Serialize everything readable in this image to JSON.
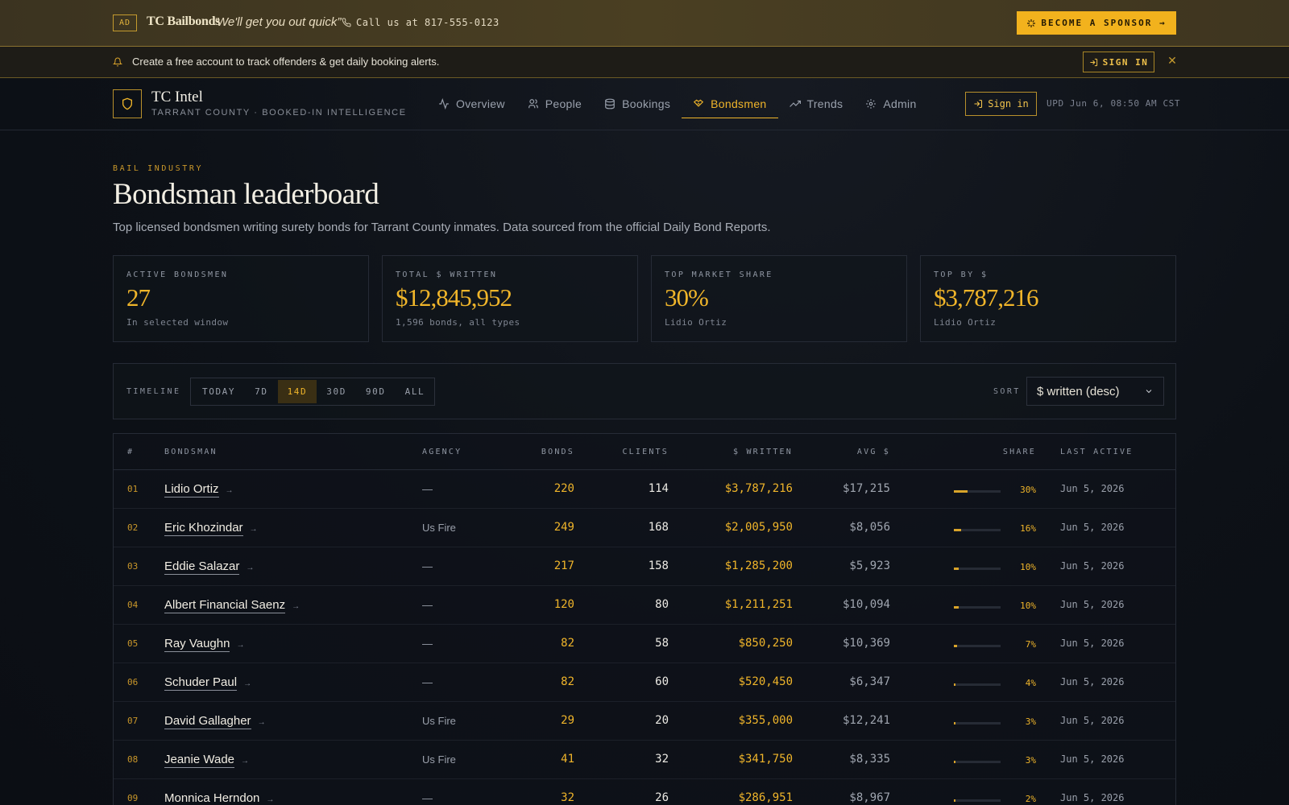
{
  "ad": {
    "tag": "AD",
    "brand": "TC Bailbonds",
    "tagline": "“We'll get you out quick”",
    "phone": "Call us at 817-555-0123",
    "sponsor_label": "BECOME A SPONSOR →"
  },
  "notice": {
    "text": "Create a free account to track offenders & get daily booking alerts.",
    "signin_label": "SIGN IN",
    "close_label": "✕"
  },
  "nav": {
    "logo_title": "TC Intel",
    "logo_subtitle": "TARRANT COUNTY · BOOKED-IN INTELLIGENCE",
    "tabs": [
      {
        "label": "Overview",
        "icon": "activity-icon"
      },
      {
        "label": "People",
        "icon": "users-icon"
      },
      {
        "label": "Bookings",
        "icon": "database-icon"
      },
      {
        "label": "Bondsmen",
        "icon": "handshake-icon",
        "active": true
      },
      {
        "label": "Trends",
        "icon": "trending-up-icon"
      },
      {
        "label": "Admin",
        "icon": "gear-icon"
      }
    ],
    "signin_label": "Sign in",
    "updated": "UPD Jun 6, 08:50 AM CST"
  },
  "hero": {
    "eyebrow": "BAIL INDUSTRY",
    "title": "Bondsman leaderboard",
    "description": "Top licensed bondsmen writing surety bonds for Tarrant County inmates. Data sourced from the official Daily Bond Reports."
  },
  "stats": [
    {
      "label": "ACTIVE BONDSMEN",
      "value": "27",
      "note": "In selected window"
    },
    {
      "label": "TOTAL $ WRITTEN",
      "value": "$12,845,952",
      "note": "1,596 bonds, all types"
    },
    {
      "label": "TOP MARKET SHARE",
      "value": "30%",
      "note": "Lidio Ortiz"
    },
    {
      "label": "TOP BY $",
      "value": "$3,787,216",
      "note": "Lidio Ortiz"
    }
  ],
  "filters": {
    "timeline_label": "TIMELINE",
    "timeline_options": [
      "TODAY",
      "7D",
      "14D",
      "30D",
      "90D",
      "ALL"
    ],
    "timeline_selected": "14D",
    "sort_label": "SORT",
    "sort_value": "$ written (desc)"
  },
  "table": {
    "headers": {
      "rank": "#",
      "name": "BONDSMAN",
      "agency": "AGENCY",
      "bonds": "BONDS",
      "clients": "CLIENTS",
      "written": "$ WRITTEN",
      "avg": "AVG $",
      "share": "SHARE",
      "last": "LAST ACTIVE"
    },
    "rows": [
      {
        "rank": "01",
        "name": "Lidio Ortiz",
        "agency": "—",
        "bonds": "220",
        "clients": "114",
        "written": "$3,787,216",
        "avg": "$17,215",
        "share": "30%",
        "share_pct": 30,
        "last": "Jun 5, 2026"
      },
      {
        "rank": "02",
        "name": "Eric Khozindar",
        "agency": "Us Fire",
        "bonds": "249",
        "clients": "168",
        "written": "$2,005,950",
        "avg": "$8,056",
        "share": "16%",
        "share_pct": 16,
        "last": "Jun 5, 2026"
      },
      {
        "rank": "03",
        "name": "Eddie Salazar",
        "agency": "—",
        "bonds": "217",
        "clients": "158",
        "written": "$1,285,200",
        "avg": "$5,923",
        "share": "10%",
        "share_pct": 10,
        "last": "Jun 5, 2026"
      },
      {
        "rank": "04",
        "name": "Albert Financial Saenz",
        "agency": "—",
        "bonds": "120",
        "clients": "80",
        "written": "$1,211,251",
        "avg": "$10,094",
        "share": "10%",
        "share_pct": 10,
        "last": "Jun 5, 2026"
      },
      {
        "rank": "05",
        "name": "Ray Vaughn",
        "agency": "—",
        "bonds": "82",
        "clients": "58",
        "written": "$850,250",
        "avg": "$10,369",
        "share": "7%",
        "share_pct": 7,
        "last": "Jun 5, 2026"
      },
      {
        "rank": "06",
        "name": "Schuder Paul",
        "agency": "—",
        "bonds": "82",
        "clients": "60",
        "written": "$520,450",
        "avg": "$6,347",
        "share": "4%",
        "share_pct": 4,
        "last": "Jun 5, 2026"
      },
      {
        "rank": "07",
        "name": "David Gallagher",
        "agency": "Us Fire",
        "bonds": "29",
        "clients": "20",
        "written": "$355,000",
        "avg": "$12,241",
        "share": "3%",
        "share_pct": 3,
        "last": "Jun 5, 2026"
      },
      {
        "rank": "08",
        "name": "Jeanie Wade",
        "agency": "Us Fire",
        "bonds": "41",
        "clients": "32",
        "written": "$341,750",
        "avg": "$8,335",
        "share": "3%",
        "share_pct": 3,
        "last": "Jun 5, 2026"
      },
      {
        "rank": "09",
        "name": "Monnica Herndon",
        "agency": "—",
        "bonds": "32",
        "clients": "26",
        "written": "$286,951",
        "avg": "$8,967",
        "share": "2%",
        "share_pct": 2,
        "last": "Jun 5, 2026"
      }
    ]
  },
  "colors": {
    "accent": "#f0b52a",
    "background": "#0d1117",
    "ad_bar": "#4a3f22"
  }
}
